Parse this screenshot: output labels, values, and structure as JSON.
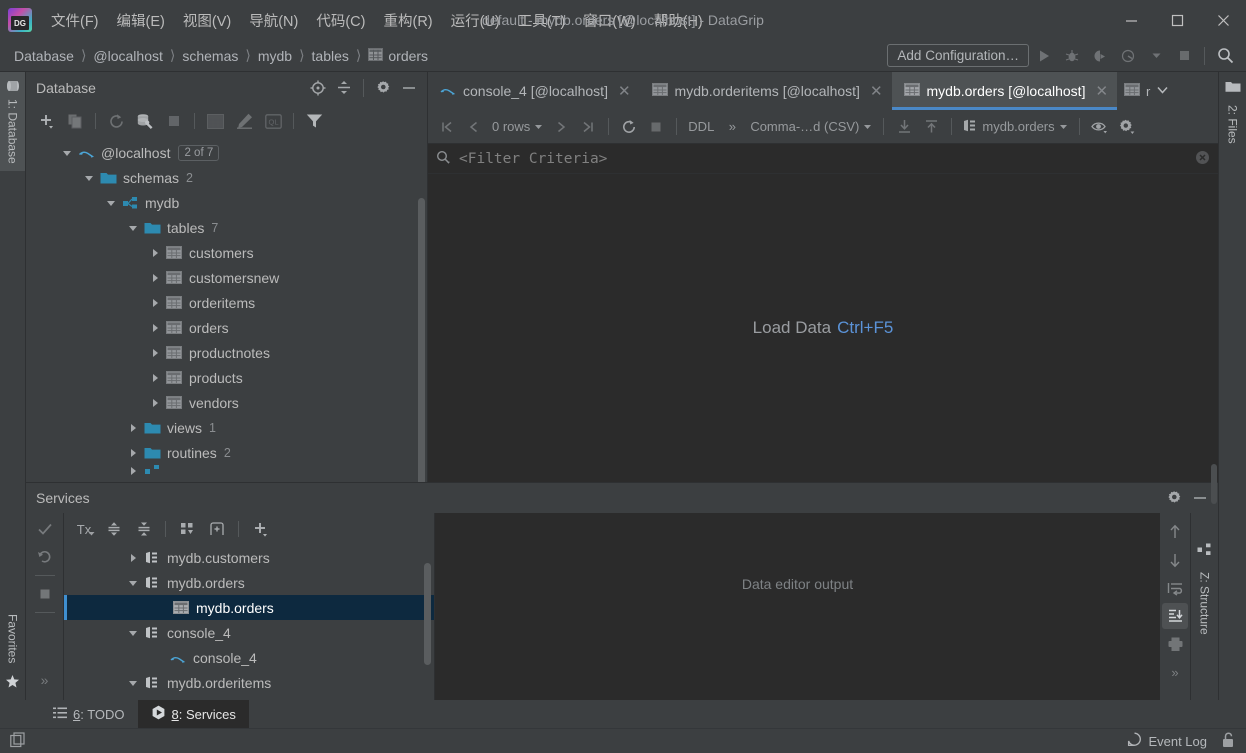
{
  "window": {
    "title": "default - mydb.orders [@localhost] - DataGrip",
    "minimize": "—",
    "maximize": "□",
    "close": "✕"
  },
  "menu": {
    "items": [
      {
        "label": "文件(F)"
      },
      {
        "label": "编辑(E)"
      },
      {
        "label": "视图(V)"
      },
      {
        "label": "导航(N)"
      },
      {
        "label": "代码(C)"
      },
      {
        "label": "重构(R)"
      },
      {
        "label": "运行(U)"
      },
      {
        "label": "工具(T)"
      },
      {
        "label": "窗口(W)"
      },
      {
        "label": "帮助(H)"
      }
    ]
  },
  "navbar": {
    "breadcrumbs": [
      "Database",
      "@localhost",
      "schemas",
      "mydb",
      "tables",
      "orders"
    ],
    "separator": "❯",
    "add_configuration": "Add Configuration…"
  },
  "left_strip": {
    "database_tab": "1: Database",
    "favorites_tab": "Favorites"
  },
  "right_strip": {
    "files_tab": "2: Files"
  },
  "database_panel": {
    "title": "Database",
    "tree": [
      {
        "label": "@localhost",
        "badge": "2 of 7",
        "indent": 0,
        "arrow": "down",
        "icon": "mysql-icon"
      },
      {
        "label": "schemas",
        "count": "2",
        "indent": 1,
        "arrow": "down",
        "icon": "folder-icon"
      },
      {
        "label": "mydb",
        "count": "",
        "indent": 2,
        "arrow": "down",
        "icon": "schema-icon"
      },
      {
        "label": "tables",
        "count": "7",
        "indent": 3,
        "arrow": "down",
        "icon": "folder-icon"
      },
      {
        "label": "customers",
        "count": "",
        "indent": 4,
        "arrow": "right",
        "icon": "table-icon"
      },
      {
        "label": "customersnew",
        "count": "",
        "indent": 4,
        "arrow": "right",
        "icon": "table-icon"
      },
      {
        "label": "orderitems",
        "count": "",
        "indent": 4,
        "arrow": "right",
        "icon": "table-icon"
      },
      {
        "label": "orders",
        "count": "",
        "indent": 4,
        "arrow": "right",
        "icon": "table-icon"
      },
      {
        "label": "productnotes",
        "count": "",
        "indent": 4,
        "arrow": "right",
        "icon": "table-icon"
      },
      {
        "label": "products",
        "count": "",
        "indent": 4,
        "arrow": "right",
        "icon": "table-icon"
      },
      {
        "label": "vendors",
        "count": "",
        "indent": 4,
        "arrow": "right",
        "icon": "table-icon"
      },
      {
        "label": "views",
        "count": "1",
        "indent": 3,
        "arrow": "right",
        "icon": "folder-icon"
      },
      {
        "label": "routines",
        "count": "2",
        "indent": 3,
        "arrow": "right",
        "icon": "folder-icon"
      }
    ]
  },
  "editor": {
    "tabs": [
      {
        "label": "console_4 [@localhost]",
        "icon": "console-icon",
        "active": false
      },
      {
        "label": "mydb.orderitems [@localhost]",
        "icon": "table-icon",
        "active": false
      },
      {
        "label": "mydb.orders [@localhost]",
        "icon": "table-icon",
        "active": true
      }
    ],
    "overflow_tab_label": "r",
    "close_glyph": "✕"
  },
  "grid_toolbar": {
    "rows_label": "0 rows",
    "ddl_label": "DDL",
    "overflow_label": "»",
    "format_label": "Comma-…d (CSV)",
    "datasource_label": "mydb.orders"
  },
  "filter": {
    "placeholder": "<Filter Criteria>"
  },
  "grid": {
    "load_data_label": "Load Data",
    "load_data_shortcut": "Ctrl+F5"
  },
  "services": {
    "title": "Services",
    "tx_label": "Tx",
    "tree": [
      {
        "label": "mydb.customers",
        "indent": 1,
        "arrow": "right",
        "icon": "datasource-icon",
        "selected": false
      },
      {
        "label": "mydb.orders",
        "indent": 1,
        "arrow": "down",
        "icon": "datasource-icon",
        "selected": false
      },
      {
        "label": "mydb.orders",
        "indent": 2,
        "arrow": "none",
        "icon": "table-icon",
        "selected": true
      },
      {
        "label": "console_4",
        "indent": 1,
        "arrow": "down",
        "icon": "datasource-icon",
        "selected": false
      },
      {
        "label": "console_4",
        "indent": 2,
        "arrow": "none",
        "icon": "console-icon",
        "selected": false
      },
      {
        "label": "mydb.orderitems",
        "indent": 1,
        "arrow": "down",
        "icon": "datasource-icon",
        "selected": false
      }
    ],
    "output_placeholder": "Data editor output",
    "structure_tab": "Z: Structure",
    "expand_glyph": "»"
  },
  "statusbar": {
    "tabs": [
      {
        "num": "6",
        "label": ": TODO",
        "icon": "todo-icon",
        "active": false
      },
      {
        "num": "8",
        "label": ": Services",
        "icon": "services-icon",
        "active": true
      }
    ],
    "event_log": "Event Log"
  },
  "colors": {
    "accent_blue": "#4a88c7",
    "link_blue": "#5b93d8",
    "selection_bg": "#0d293f",
    "panel_bg": "#3c3f41",
    "editor_bg": "#2b2b2b",
    "folder_teal": "#2d8ab0"
  }
}
